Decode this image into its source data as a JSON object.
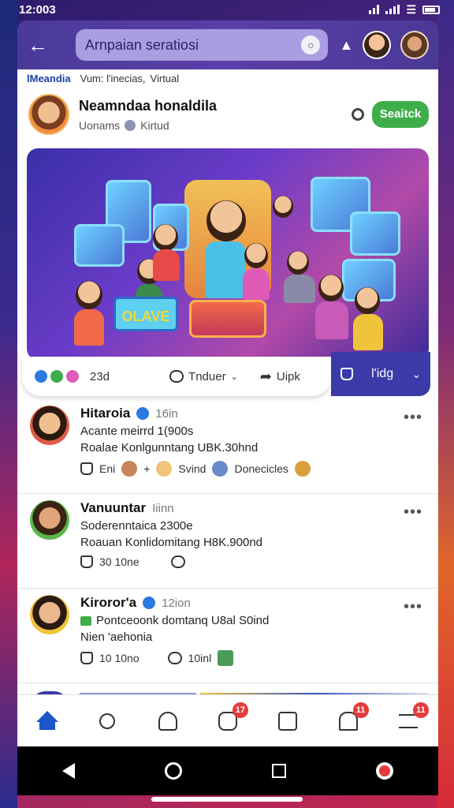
{
  "status_bar": {
    "time": "12:003"
  },
  "header": {
    "search_text": "Arnpaian seratiosi"
  },
  "crumbs": [
    "lMeandia",
    "Vum: l'inecias,",
    "Virtual"
  ],
  "post": {
    "author": "Neamndaa honaldila",
    "sub_prefix": "Uonams",
    "sub_label": "Kirtud",
    "follow_label": "Seaitck",
    "hero_sign": "OLAVE",
    "reaction_count": "23d",
    "action_1": "Tnduer",
    "action_2": "Uipk",
    "action_3": "l'idg"
  },
  "comments": [
    {
      "name": "Hitaroia",
      "verified": true,
      "time": "16in",
      "line1": "Acante meirrd 1(900s",
      "line2": "Roalae Konlgunntang UBK.30hnd",
      "actions": [
        "Eni",
        "Svind",
        "Donecicles"
      ]
    },
    {
      "name": "Vanuuntar",
      "verified": false,
      "time": "Iiinn",
      "line1": "Soderenntaica 2300e",
      "line2": "Roauan Konlidomitang H8K.900nd",
      "actions": [
        "30 10ne"
      ]
    },
    {
      "name": "Kiroror'a",
      "verified": true,
      "time": "12ion",
      "line1": "Pontceoonk domtanq U8al S0ind",
      "line2": "Nien 'aehonia",
      "actions": [
        "10 10no",
        "10inl"
      ]
    }
  ],
  "tab_bar": {
    "badges": [
      "17",
      "11",
      "11"
    ]
  },
  "colors": {
    "accent_header": "#4a3a9a",
    "follow_green": "#3fae4a",
    "verified_blue": "#2a7ae2",
    "badge_red": "#e53b3b"
  }
}
